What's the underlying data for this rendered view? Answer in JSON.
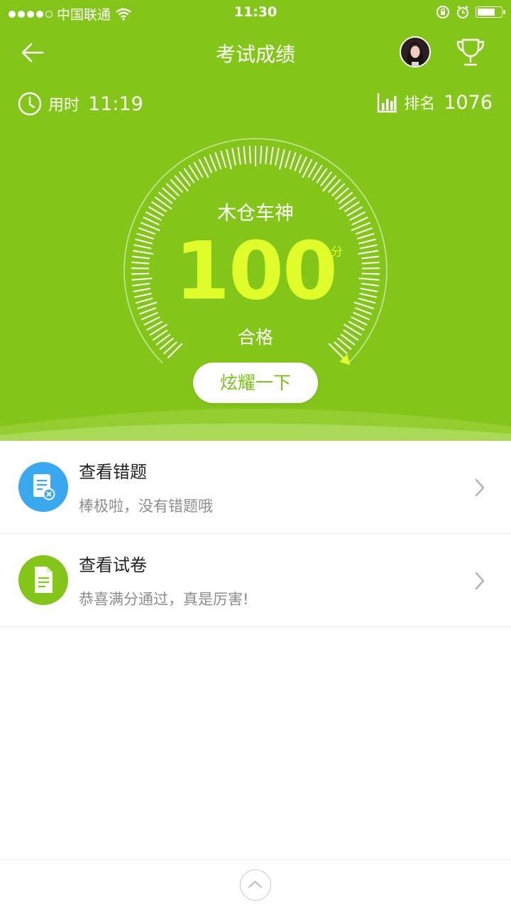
{
  "status_bar": {
    "carrier": "中国联通",
    "time": "11:30"
  },
  "nav": {
    "title": "考试成绩",
    "back_icon": "back-arrow-icon",
    "trophy_icon": "trophy-icon"
  },
  "stats": {
    "time_label": "用时",
    "time_value": "11:19",
    "rank_label": "排名",
    "rank_value": "1076"
  },
  "result": {
    "nickname": "木仓车神",
    "score": "100",
    "unit": "分",
    "verdict": "合格",
    "share_label": "炫耀一下",
    "gauge_fraction": 1.0
  },
  "items": [
    {
      "title": "查看错题",
      "subtitle": "棒极啦，没有错题哦",
      "icon": "wrong-questions-icon",
      "color": "#3aa8ef"
    },
    {
      "title": "查看试卷",
      "subtitle": "恭喜满分通过，真是厉害!",
      "icon": "exam-paper-icon",
      "color": "#84c51a"
    }
  ],
  "colors": {
    "brand_green": "#84c51a",
    "score_yellow": "#e0fc2a",
    "blue": "#3aa8ef"
  }
}
